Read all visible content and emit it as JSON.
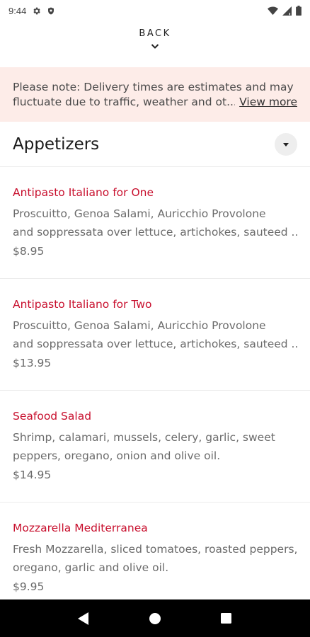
{
  "status_bar": {
    "time": "9:44",
    "icons": [
      "gear-icon",
      "shield-icon",
      "wifi-icon",
      "signal-icon",
      "battery-icon"
    ]
  },
  "back": {
    "label": "BACK",
    "icon": "chevron-down-icon"
  },
  "notice": {
    "line1": "Please note: Delivery times are estimates and may",
    "line2": "fluctuate due to traffic, weather and ot...",
    "link": "View more",
    "background": "#fdece8"
  },
  "section": {
    "title": "Appetizers",
    "toggle_icon": "caret-down-icon"
  },
  "menu_items": [
    {
      "name": "Antipasto Italiano for One",
      "desc_line1": "Proscuitto, Genoa Salami, Auricchio Provolone",
      "desc_line2": "and soppressata over lettuce, artichokes, sauteed ...",
      "price": "$8.95"
    },
    {
      "name": "Antipasto Italiano for Two",
      "desc_line1": "Proscuitto, Genoa Salami, Auricchio Provolone",
      "desc_line2": "and soppressata over lettuce, artichokes, sauteed ...",
      "price": "$13.95"
    },
    {
      "name": "Seafood Salad",
      "desc_line1": "Shrimp, calamari, mussels, celery, garlic, sweet",
      "desc_line2": "peppers, oregano, onion and olive oil.",
      "price": "$14.95"
    },
    {
      "name": "Mozzarella Mediterranea",
      "desc_line1": "Fresh Mozzarella, sliced tomatoes, roasted peppers,",
      "desc_line2": "oregano, garlic and olive oil.",
      "price": "$9.95"
    }
  ],
  "colors": {
    "accent": "#c8102e",
    "text_muted": "#6b6b6b",
    "nav_bar": "#000000"
  },
  "nav_bar": {
    "icons": [
      "back-triangle-icon",
      "home-circle-icon",
      "recents-square-icon"
    ]
  }
}
